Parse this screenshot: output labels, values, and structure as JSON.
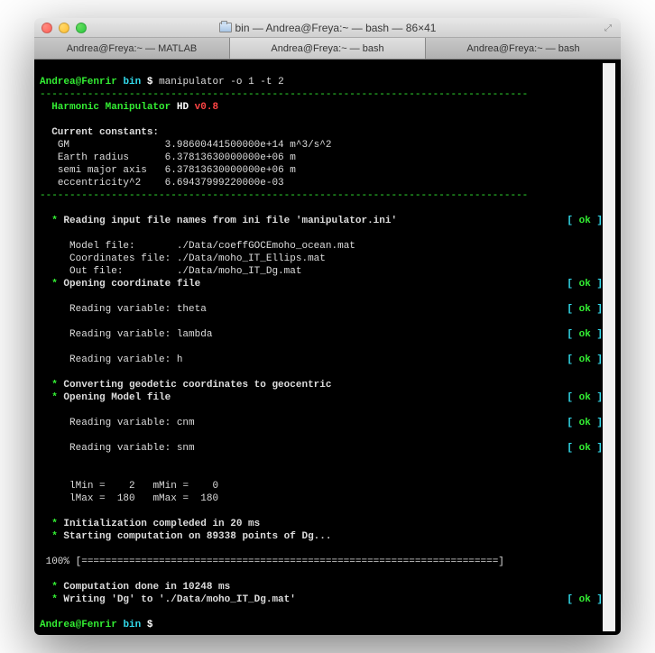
{
  "window": {
    "title": "bin — Andrea@Freya:~ — bash — 86×41"
  },
  "tabs": [
    {
      "label": "Andrea@Freya:~ — MATLAB"
    },
    {
      "label": "Andrea@Freya:~ — bash"
    },
    {
      "label": "Andrea@Freya:~ — bash"
    }
  ],
  "prompt": {
    "user_host": "Andrea@Fenrir",
    "cwd": "bin",
    "symbol": "$"
  },
  "command": "manipulator -o 1 -t 2",
  "divider": "----------------------------------------------------------------------------------",
  "banner": {
    "name": "Harmonic Manipulator",
    "hd": "HD",
    "version": "v0.8"
  },
  "constants_header": "Current constants:",
  "constants": [
    {
      "label": "GM",
      "value": "3.98600441500000e+14 m^3/s^2"
    },
    {
      "label": "Earth radius",
      "value": "6.37813630000000e+06 m"
    },
    {
      "label": "semi major axis",
      "value": "6.37813630000000e+06 m"
    },
    {
      "label": "eccentricity^2",
      "value": "6.69437999220000e-03"
    }
  ],
  "step_read_ini": "Reading input file names from ini file 'manipulator.ini'",
  "files": {
    "model_label": "Model file:",
    "model_value": "./Data/coeffGOCEmoho_ocean.mat",
    "coords_label": "Coordinates file:",
    "coords_value": "./Data/moho_IT_Ellips.mat",
    "out_label": "Out file:",
    "out_value": "./Data/moho_IT_Dg.mat"
  },
  "step_open_coord": "Opening coordinate file",
  "read_vars_coord": [
    "Reading variable: theta",
    "Reading variable: lambda",
    "Reading variable: h"
  ],
  "step_convert": "Converting geodetic coordinates to geocentric",
  "step_open_model": "Opening Model file",
  "read_vars_model": [
    "Reading variable: cnm",
    "Reading variable: snm"
  ],
  "ranges": {
    "lmin": "lMin =    2",
    "mmin": "mMin =    0",
    "lmax": "lMax =  180",
    "mmax": "mMax =  180"
  },
  "init_msg": "Initialization compleded in 20 ms",
  "start_msg": "Starting computation on 89338 points of Dg...",
  "progress_pct": "100%",
  "progress_bar": "[======================================================================]",
  "done_msg": "Computation done in 10248 ms",
  "write_msg": "Writing 'Dg' to './Data/moho_IT_Dg.mat'",
  "ok": "ok",
  "bracket_open": "[ ",
  "bracket_close": " ]"
}
